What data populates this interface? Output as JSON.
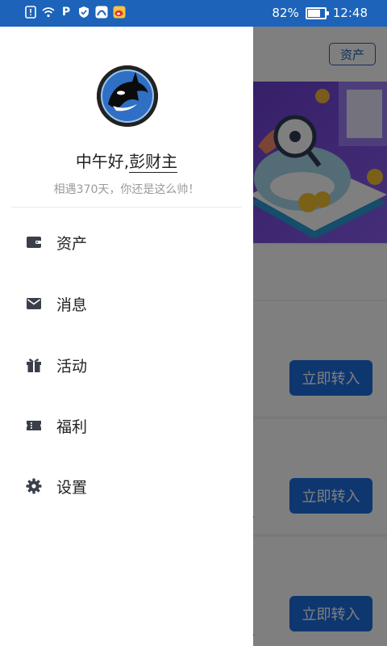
{
  "status_bar": {
    "battery": "82%",
    "battery_level": 0.82,
    "time": "12:48"
  },
  "background": {
    "asset_button": "资产",
    "transfer_buttons": [
      "立即转入",
      "立即转入",
      "立即转入"
    ],
    "partial_text": [
      "息",
      "息"
    ]
  },
  "drawer": {
    "greeting_prefix": "中午好,",
    "user_name": "彭财主",
    "subtitle": "相遇370天，你还是这么帅！",
    "menu": [
      {
        "label": "资产",
        "icon": "wallet-icon"
      },
      {
        "label": "消息",
        "icon": "mail-icon"
      },
      {
        "label": "活动",
        "icon": "gift-icon"
      },
      {
        "label": "福利",
        "icon": "ticket-icon"
      },
      {
        "label": "设置",
        "icon": "gear-icon"
      }
    ]
  },
  "colors": {
    "status_bar": "#1c63b9",
    "accent": "#1c6fe0",
    "icon": "#3a3f4a"
  }
}
